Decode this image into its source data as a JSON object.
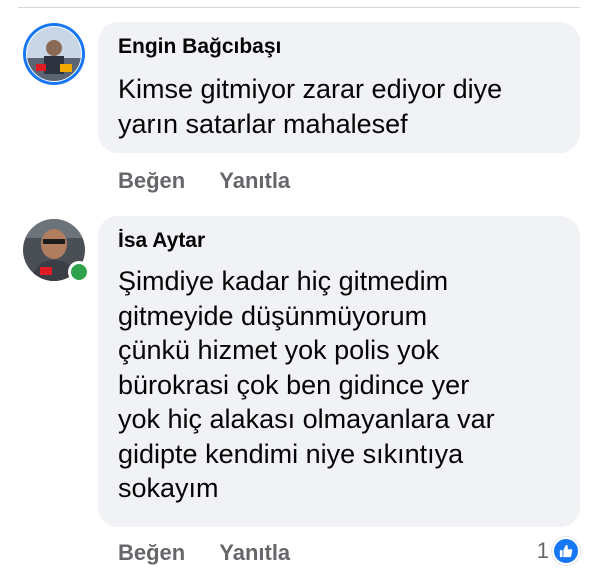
{
  "comments": [
    {
      "author": "Engin Bağcıbaşı",
      "text_lines": [
        "Kimse gitmiyor zarar ediyor diye",
        "yarın satarlar mahalesef"
      ],
      "actions": {
        "like": "Beğen",
        "reply": "Yanıtla"
      },
      "online": false
    },
    {
      "author": "İsa Aytar",
      "text_lines": [
        "Şimdiye kadar hiç gitmedim",
        "gitmeyide düşünmüyorum",
        "çünkü hizmet yok polis yok",
        "bürokrasi çok ben gidince yer",
        "yok hiç alakası olmayanlara var",
        "gidipte kendimi niye sıkıntıya",
        "sokayım"
      ],
      "actions": {
        "like": "Beğen",
        "reply": "Yanıtla"
      },
      "online": true,
      "reaction": {
        "icon": "thumbs-up-icon",
        "count": "1",
        "color": "#1877f2"
      }
    }
  ]
}
